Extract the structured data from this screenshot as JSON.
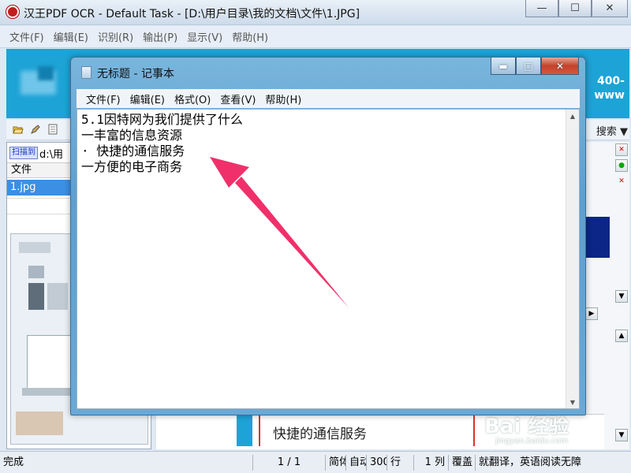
{
  "main_window": {
    "title": "汉王PDF OCR - Default Task - [D:\\用户目录\\我的文档\\文件\\1.JPG]",
    "controls": {
      "minimize": "—",
      "maximize": "☐",
      "close": "✕"
    },
    "menu": [
      "文件(F)",
      "编辑(E)",
      "识别(R)",
      "输出(P)",
      "显示(V)",
      "帮助(H)"
    ],
    "banner_phone_lines": [
      "400-",
      "www"
    ],
    "toolbar_right_label": "搜索",
    "left_panel": {
      "scan_button": "扫描到",
      "scan_path": "d:\\用",
      "file_header": "文件",
      "files": [
        "1.jpg"
      ]
    },
    "doc_preview_text": "快捷的通信服务",
    "status_bar": [
      "完成",
      "1 / 1",
      "简体",
      "自动",
      "300",
      "行",
      "1 列",
      "覆盖",
      "就翻译，英语阅读无障"
    ]
  },
  "notepad": {
    "title": "无标题 - 记事本",
    "menu": [
      "文件(F)",
      "编辑(E)",
      "格式(O)",
      "查看(V)",
      "帮助(H)"
    ],
    "lines": [
      "5.1因特网为我们提供了什么",
      "一丰富的信息资源",
      "· 快捷的通信服务",
      "一方便的电子商务"
    ]
  },
  "watermark": {
    "text": "Bai 经验",
    "sub": "jingyan.baidu.com"
  },
  "colors": {
    "annotation_arrow": "#f0306a",
    "banner": "#1ea3d6",
    "selection": "#3b8fe4",
    "notepad_frame": "#6aa9d6"
  }
}
